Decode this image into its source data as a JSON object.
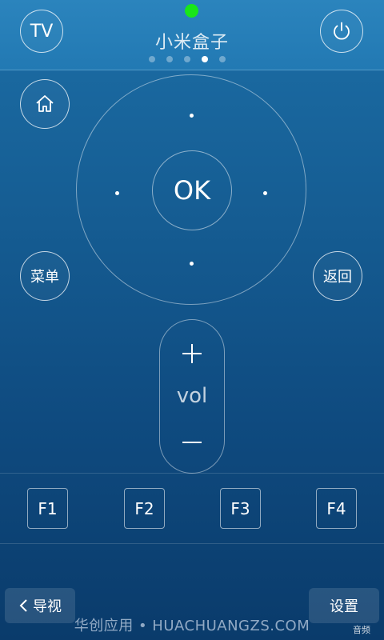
{
  "header": {
    "tv_label": "TV",
    "title": "小米盒子",
    "pages": [
      false,
      false,
      false,
      true,
      false
    ]
  },
  "colors": {
    "status": "#19e619",
    "header_bg": "#2279b3",
    "body_bg": "#155c92"
  },
  "side_buttons": {
    "menu": "菜单",
    "back": "返回"
  },
  "dpad": {
    "ok_label": "OK"
  },
  "volume": {
    "label": "vol"
  },
  "function_keys": [
    "F1",
    "F2",
    "F3",
    "F4"
  ],
  "bottom": {
    "nav_label": "导视",
    "settings_label": "设置",
    "watermark": "华创应用 • HUACHUANGZS.COM",
    "audio_label": "音频"
  },
  "icons": [
    "power-icon",
    "home-icon",
    "plus-icon",
    "minus-icon",
    "chevron-left-icon"
  ]
}
